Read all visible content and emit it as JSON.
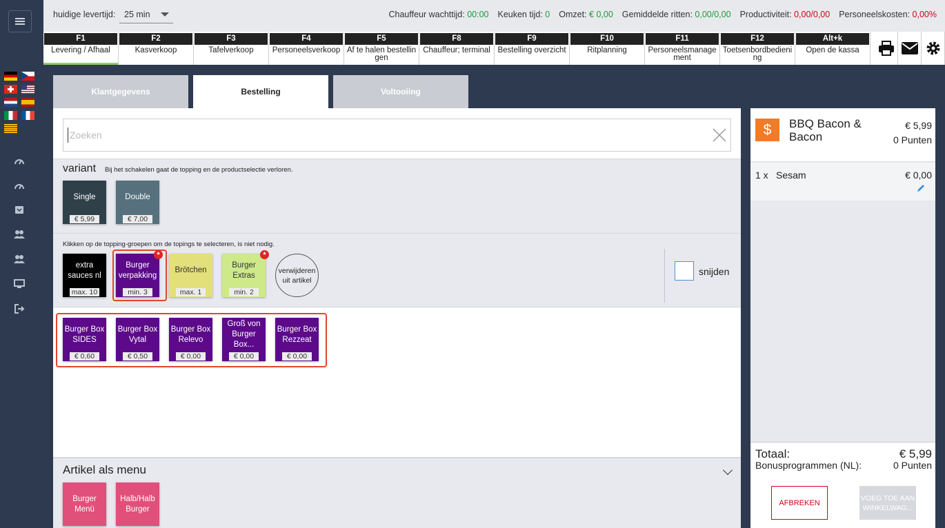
{
  "topbar": {
    "delivery_time_label": "huidige levertijd:",
    "delivery_time_value": "25 min",
    "stats": [
      {
        "label": "Chauffeur wachttijd:",
        "value": "00:00",
        "color": "green"
      },
      {
        "label": "Keuken tijd:",
        "value": "0",
        "color": "green"
      },
      {
        "label": "Omzet:",
        "value": "€ 0,00",
        "color": "green"
      },
      {
        "label": "Gemiddelde ritten:",
        "value": "0,00/0,00",
        "color": "green"
      },
      {
        "label": "Productiviteit:",
        "value": "0,00/0,00",
        "color": "red"
      },
      {
        "label": "Personeelskosten:",
        "value": "0,00%",
        "color": "red"
      }
    ]
  },
  "fkeys": [
    {
      "key": "F1",
      "label": "Levering / Afhaal",
      "active": true
    },
    {
      "key": "F2",
      "label": "Kasverkoop"
    },
    {
      "key": "F3",
      "label": "Tafelverkoop"
    },
    {
      "key": "F4",
      "label": "Personeelsverkoop"
    },
    {
      "key": "F5",
      "label": "Af te halen bestellingen"
    },
    {
      "key": "F8",
      "label": "Chauffeur; terminal"
    },
    {
      "key": "F9",
      "label": "Bestelling overzicht"
    },
    {
      "key": "F10",
      "label": "Ritplanning"
    },
    {
      "key": "F11",
      "label": "Personeelsmanagement"
    },
    {
      "key": "F12",
      "label": "Toetsenbordbediening"
    },
    {
      "key": "Alt+k",
      "label": "Open de kassa"
    }
  ],
  "tabs": [
    "Klantgegevens",
    "Bestelling",
    "Voltooiing"
  ],
  "search": {
    "placeholder": "Zoeken"
  },
  "variant": {
    "title": "variant",
    "hint": "Bij het schakelen gaat de topping en de productselectie verloren.",
    "options": [
      {
        "name": "Single",
        "price": "€ 5,99",
        "color": "#2f4049"
      },
      {
        "name": "Double",
        "price": "€ 7,00",
        "color": "#56707d"
      }
    ]
  },
  "toppings": {
    "hint": "Klikken op de topping-groepen om de topings te selecteren, is niet nodig.",
    "groups": [
      {
        "name": "extra sauces nl",
        "req": "max. 10",
        "color": "#000000",
        "text": "#ffffff",
        "required": false
      },
      {
        "name": "Burger verpakking",
        "req": "min. 3",
        "color": "#5c0a8a",
        "text": "#ffffff",
        "required": true
      },
      {
        "name": "Brötchen",
        "req": "max. 1",
        "color": "#e3df7a",
        "text": "#333333",
        "required": false
      },
      {
        "name": "Burger Extras",
        "req": "min. 2",
        "color": "#cde98a",
        "text": "#333333",
        "required": true
      }
    ],
    "remove_label": "verwijderen uit artikel",
    "cut_label": "snijden",
    "badge": "*"
  },
  "products": [
    {
      "name": "Burger Box SIDES",
      "price": "€ 0,60"
    },
    {
      "name": "Burger Box Vytal",
      "price": "€ 0,50"
    },
    {
      "name": "Burger Box Relevo",
      "price": "€ 0,00"
    },
    {
      "name": "Groß von Burger Box...",
      "price": "€ 0,00"
    },
    {
      "name": "Burger Box Rezzeat",
      "price": "€ 0,00"
    }
  ],
  "menu": {
    "title": "Artikel als menu",
    "items": [
      "Burger Menü",
      "Halb/Halb Burger"
    ]
  },
  "cart": {
    "currency_icon": "$",
    "item_name": "BBQ Bacon & Bacon",
    "item_price": "€ 5,99",
    "item_points": "0 Punten",
    "lines": [
      {
        "qty": "1 x",
        "name": "Sesam",
        "price": "€ 0,00"
      }
    ],
    "total_label": "Totaal:",
    "total_value": "€ 5,99",
    "bonus_label": "Bonusprogrammen (NL):",
    "bonus_value": "0 Punten",
    "abort_label": "AFBREKEN",
    "add_label": "VOEG TOE AAN WINKELWAG..."
  },
  "colors": {
    "product_tile": "#5c0a8a",
    "menu_tile": "#e0507a",
    "selection_frame": "#e2452c",
    "accent_orange": "#f07c28"
  }
}
